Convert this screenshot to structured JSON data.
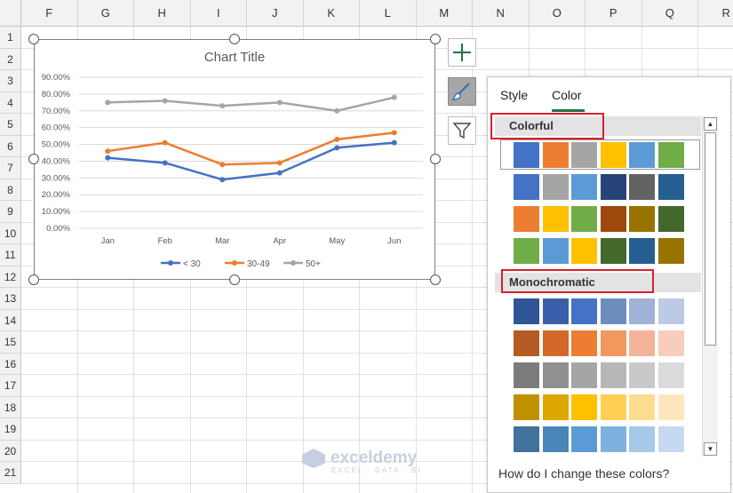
{
  "columns": [
    "F",
    "G",
    "H",
    "I",
    "J",
    "K",
    "L",
    "M",
    "N",
    "O",
    "P",
    "Q",
    "R"
  ],
  "rows": [
    "1",
    "2",
    "3",
    "4",
    "5",
    "6",
    "7",
    "8",
    "9",
    "10",
    "11",
    "12",
    "13",
    "14",
    "15",
    "16",
    "17",
    "18",
    "19",
    "20",
    "21"
  ],
  "chart": {
    "title": "Chart Title",
    "legend": [
      {
        "name": "< 30",
        "color": "#4472c4"
      },
      {
        "name": "30-49",
        "color": "#ed7d31"
      },
      {
        "name": "50+",
        "color": "#a5a5a5"
      }
    ]
  },
  "chart_data": {
    "type": "line",
    "title": "Chart Title",
    "categories": [
      "Jan",
      "Feb",
      "Mar",
      "Apr",
      "May",
      "Jun"
    ],
    "yticks": [
      "0.00%",
      "10.00%",
      "20.00%",
      "30.00%",
      "40.00%",
      "50.00%",
      "60.00%",
      "70.00%",
      "80.00%",
      "90.00%"
    ],
    "ylim": [
      0,
      0.9
    ],
    "grid": true,
    "legend_position": "bottom",
    "series": [
      {
        "name": "< 30",
        "color": "#4472c4",
        "values": [
          0.42,
          0.39,
          0.29,
          0.33,
          0.48,
          0.51
        ]
      },
      {
        "name": "30-49",
        "color": "#ed7d31",
        "values": [
          0.46,
          0.51,
          0.38,
          0.39,
          0.53,
          0.57
        ]
      },
      {
        "name": "50+",
        "color": "#a5a5a5",
        "values": [
          0.75,
          0.76,
          0.73,
          0.75,
          0.7,
          0.78
        ]
      }
    ]
  },
  "side_buttons": {
    "elements": "plus-icon",
    "styles": "paintbrush-icon",
    "filters": "funnel-icon"
  },
  "panel": {
    "tabs": [
      "Style",
      "Color"
    ],
    "active_tab": "Color",
    "colorful_label": "Colorful",
    "monochromatic_label": "Monochromatic",
    "help_text": "How do I change these colors?",
    "colorful_rows": [
      [
        "#4472c4",
        "#ed7d31",
        "#a5a5a5",
        "#ffc000",
        "#5b9bd5",
        "#70ad47"
      ],
      [
        "#4472c4",
        "#a5a5a5",
        "#5b9bd5",
        "#264478",
        "#636363",
        "#255e91"
      ],
      [
        "#ed7d31",
        "#ffc000",
        "#70ad47",
        "#9e480e",
        "#997300",
        "#43682b"
      ],
      [
        "#70ad47",
        "#5b9bd5",
        "#ffc000",
        "#43682b",
        "#255e91",
        "#997300"
      ]
    ],
    "mono_rows": [
      [
        "#2f5597",
        "#3a5faa",
        "#4472c4",
        "#6c8ebf",
        "#9fb3d9",
        "#bccae6"
      ],
      [
        "#b55a23",
        "#d2692a",
        "#ed7d31",
        "#f1985f",
        "#f4b39a",
        "#f8cdbd"
      ],
      [
        "#7b7b7b",
        "#909090",
        "#a5a5a5",
        "#b7b7b7",
        "#c9c9c9",
        "#dbdbdb"
      ],
      [
        "#bf9000",
        "#dfa800",
        "#ffc000",
        "#ffcf55",
        "#ffdb90",
        "#ffe7bd"
      ],
      [
        "#41719c",
        "#4a85ba",
        "#5b9bd5",
        "#7fb1de",
        "#a6c8e9",
        "#c5daf1"
      ]
    ]
  },
  "watermark": {
    "brand": "exceldemy",
    "tagline": "EXCEL · DATA · BI"
  }
}
